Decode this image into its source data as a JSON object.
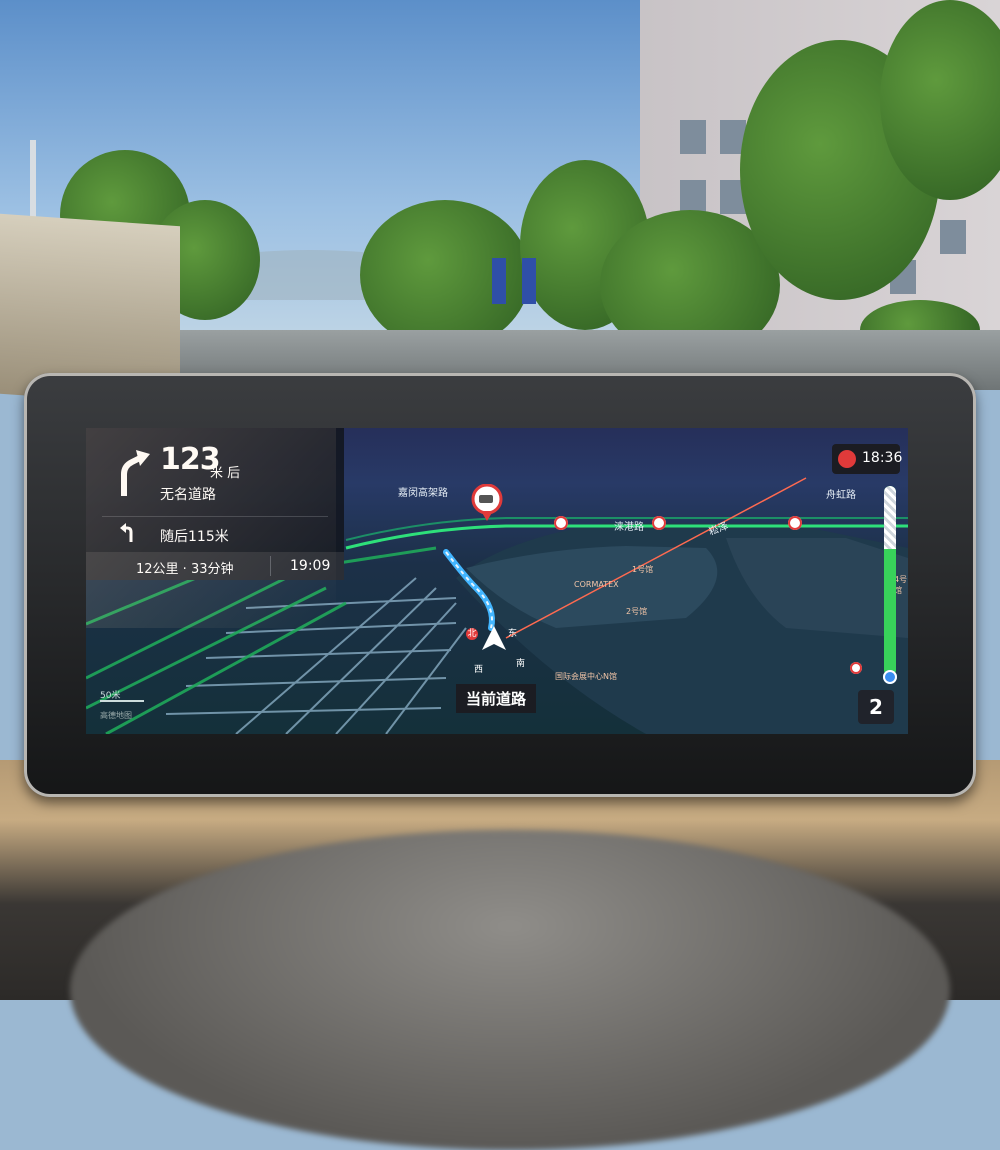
{
  "navigation": {
    "guidance": {
      "turn_icon": "turn-right-arrow-icon",
      "distance": "123",
      "distance_unit": "米 后",
      "road_name": "无名道路",
      "next_icon": "turn-left-small-icon",
      "next_instruction": "随后115米",
      "trip_summary": "12公里 · 33分钟",
      "arrival_time": "19:09"
    },
    "clock": {
      "icon": "alert-icon",
      "time": "18:36"
    },
    "current_road": "当前道路",
    "compass": {
      "north": "北",
      "east": "东",
      "south": "南",
      "west": "西"
    },
    "scale": {
      "label": "50米",
      "provider": "高德地图"
    },
    "map_labels": {
      "road1": "嘉闵高架路",
      "road2": "涞港路",
      "road3": "舟虹路",
      "road4": "崧泽",
      "poi_cormatex": "CORMATEX",
      "poi_hall1": "1号馆",
      "poi_hall2": "2号馆",
      "poi_hall4": "4号馆",
      "poi_center": "国际会展中心N馆"
    },
    "zoom_button": "2",
    "route_progress": 0.33,
    "colors": {
      "route_green": "#38d25a",
      "route_blue": "#43b6ff",
      "alert_red": "#e03a3a"
    }
  }
}
